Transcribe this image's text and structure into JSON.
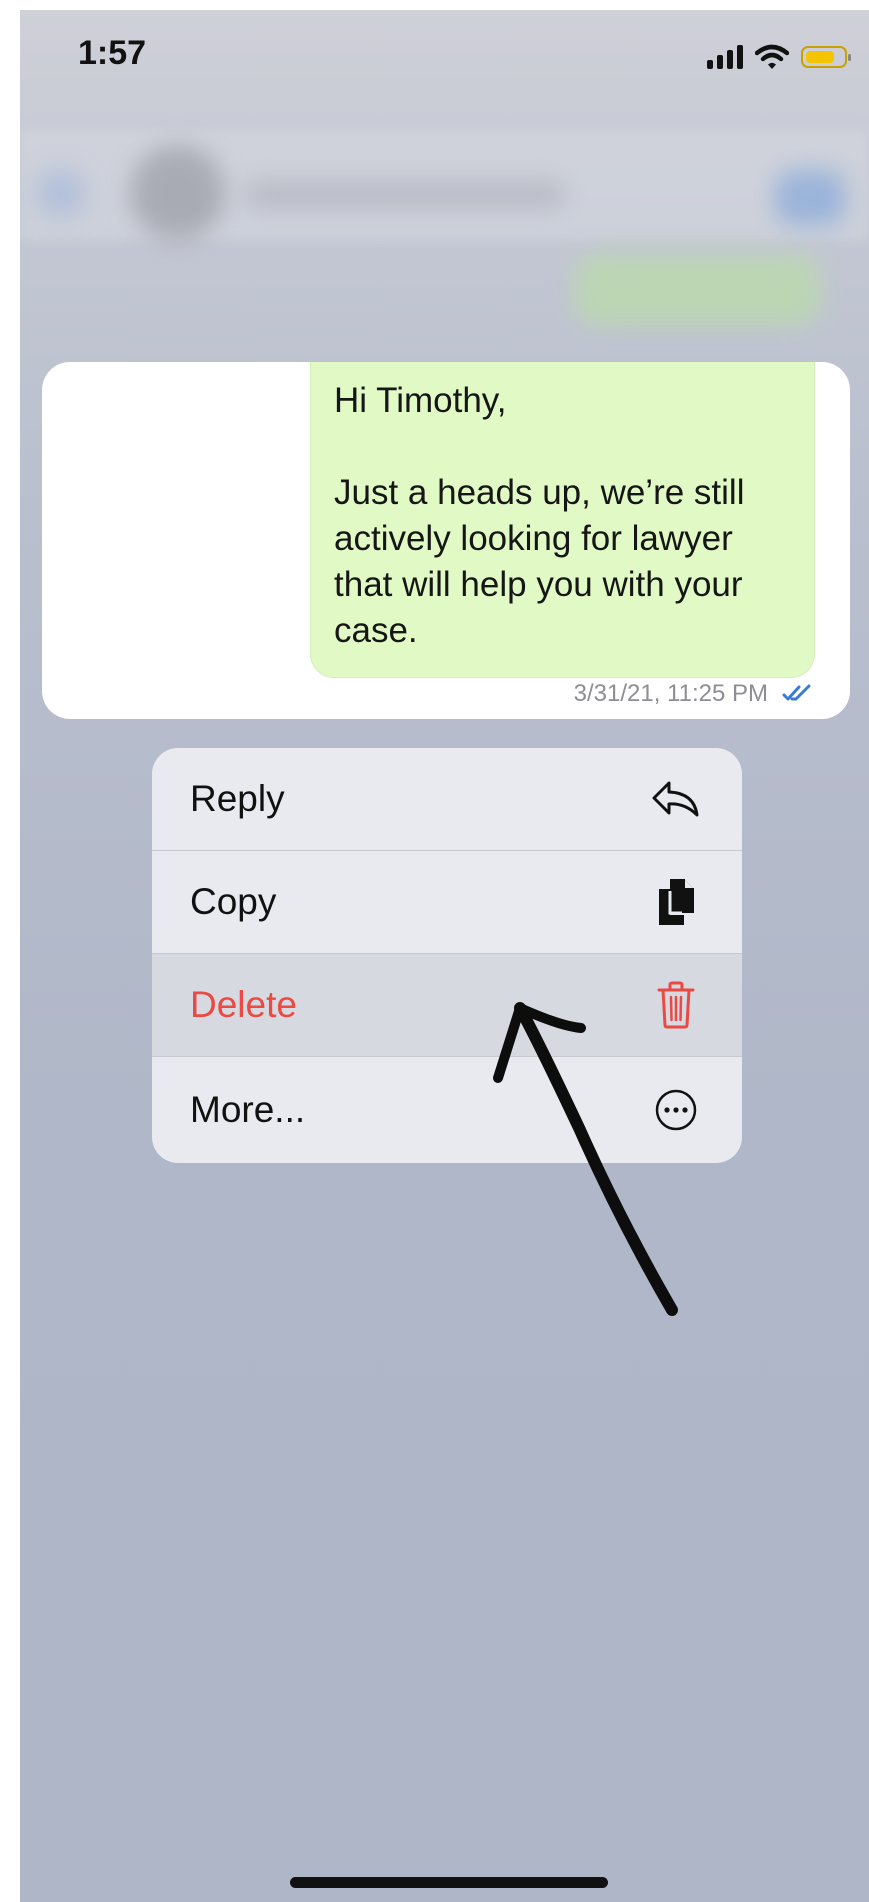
{
  "status_bar": {
    "time": "1:57",
    "icons": [
      "signal-icon",
      "wifi-icon",
      "battery-icon"
    ],
    "battery_color": "#f5c400"
  },
  "message": {
    "greeting": "Hi Timothy,",
    "body": "Just a heads up, we’re still actively looking for lawyer that will help you with your case.",
    "timestamp": "3/31/21, 11:25 PM",
    "status_icon": "double-check-icon",
    "bubble_color": "#e0f9c5"
  },
  "context_menu": {
    "items": [
      {
        "label": "Reply",
        "icon": "reply-icon"
      },
      {
        "label": "Copy",
        "icon": "copy-icon"
      },
      {
        "label": "Delete",
        "icon": "trash-icon",
        "color": "#ea4a43",
        "highlighted": true
      },
      {
        "label": "More...",
        "icon": "more-icon"
      }
    ]
  },
  "annotation": {
    "type": "hand-drawn-arrow",
    "points_to": "Delete"
  }
}
